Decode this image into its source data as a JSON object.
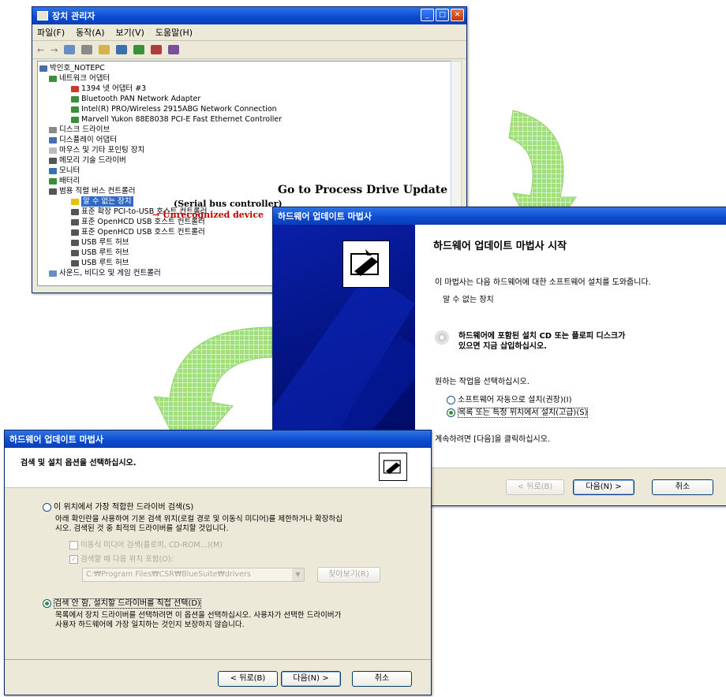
{
  "device_manager": {
    "title": "장치 관리자",
    "menu": [
      "파일(F)",
      "동작(A)",
      "보기(V)",
      "도움말(H)"
    ],
    "tree": [
      {
        "label": "박인호_NOTEPC",
        "level": 0
      },
      {
        "label": "네트워크 어댑터",
        "level": 1
      },
      {
        "label": "1394 넷 어댑터 #3",
        "level": 2
      },
      {
        "label": "Bluetooth PAN Network Adapter",
        "level": 2
      },
      {
        "label": "Intel(R) PRO/Wireless 2915ABG Network Connection",
        "level": 2
      },
      {
        "label": "Marvell Yukon 88E8038 PCI-E Fast Ethernet Controller",
        "level": 2
      },
      {
        "label": "디스크 드라이브",
        "level": 1
      },
      {
        "label": "디스플레이 어댑터",
        "level": 1
      },
      {
        "label": "마우스 및 기타 포인팅 장치",
        "level": 1
      },
      {
        "label": "메모리 기술 드라이버",
        "level": 1
      },
      {
        "label": "모니터",
        "level": 1
      },
      {
        "label": "배터리",
        "level": 1
      },
      {
        "label": "범용 직렬 버스 컨트롤러",
        "level": 1
      },
      {
        "label": "알 수 없는 장치",
        "level": 2
      },
      {
        "label": "표준 확장 PCI-to-USB 호스트 컨트롤러",
        "level": 2
      },
      {
        "label": "표준 OpenHCD USB 호스트 컨트롤러",
        "level": 2
      },
      {
        "label": "표준 OpenHCD USB 호스트 컨트롤러",
        "level": 2
      },
      {
        "label": "USB 루트 허브",
        "level": 2
      },
      {
        "label": "USB 루트 허브",
        "level": 2
      },
      {
        "label": "USB 루트 허브",
        "level": 2
      },
      {
        "label": "사운드, 비디오 및 게임 컨트롤러",
        "level": 1
      }
    ]
  },
  "annotations": {
    "serial_bus": "(Serial bus controller)",
    "unrecognized": "→ Unrecognized device",
    "go_to": "Go to Process Drive Update"
  },
  "wizard1": {
    "title": "하드웨어 업데이트 마법사",
    "heading": "하드웨어 업데이트 마법사 시작",
    "intro": "이 마법사는 다음 하드웨어에 대한 소프트웨어 설치를 도와줍니다.",
    "device": "알 수 없는 장치",
    "cd_note_1": "하드웨어에 포함된 설치 CD 또는 플로피 디스크가",
    "cd_note_2": "있으면 지금 삽입하십시오.",
    "question": "원하는 작업을 선택하십시오.",
    "option_auto": "소프트웨어 자동으로 설치(권장)(I)",
    "option_manual": "목록 또는 특정 위치에서 설치(고급)(S)",
    "continue": "계속하려면 [다음]을 클릭하십시오.",
    "btn_back": "< 뒤로(B)",
    "btn_next": "다음(N) >",
    "btn_cancel": "취소"
  },
  "wizard2": {
    "title": "하드웨어 업데이트 마법사",
    "heading": "검색 및 설치 옵션을 선택하십시오.",
    "option_search": "이 위치에서 가장 적합한 드라이버 검색(S)",
    "search_desc_1": "아래 확인란을 사용하여 기본 검색 위치(로컬 경로 및 이동식 미디어)를 제한하거나 확장하십",
    "search_desc_2": "시오. 검색된 것 중 최적의 드라이버를 설치할 것입니다.",
    "chk_media": "이동식 미디어 검색(플로피, CD-ROM...)(M)",
    "chk_location": "검색할 때 다음 위치 포함(O):",
    "path": "C:₩Program Files₩CSR₩BlueSuite₩drivers",
    "btn_browse": "찾아보기(R)",
    "option_manual": "검색 안 함, 설치할 드라이버를 직접 선택(D)",
    "manual_desc_1": "목록에서 장치 드라이버를 선택하려면 이 옵션을 선택하십시오. 사용자가 선택한 드라이버가",
    "manual_desc_2": "사용자 하드웨어에 가장 일치하는 것인지 보장하지 않습니다.",
    "btn_back": "< 뒤로(B)",
    "btn_next": "다음(N) >",
    "btn_cancel": "취소"
  }
}
